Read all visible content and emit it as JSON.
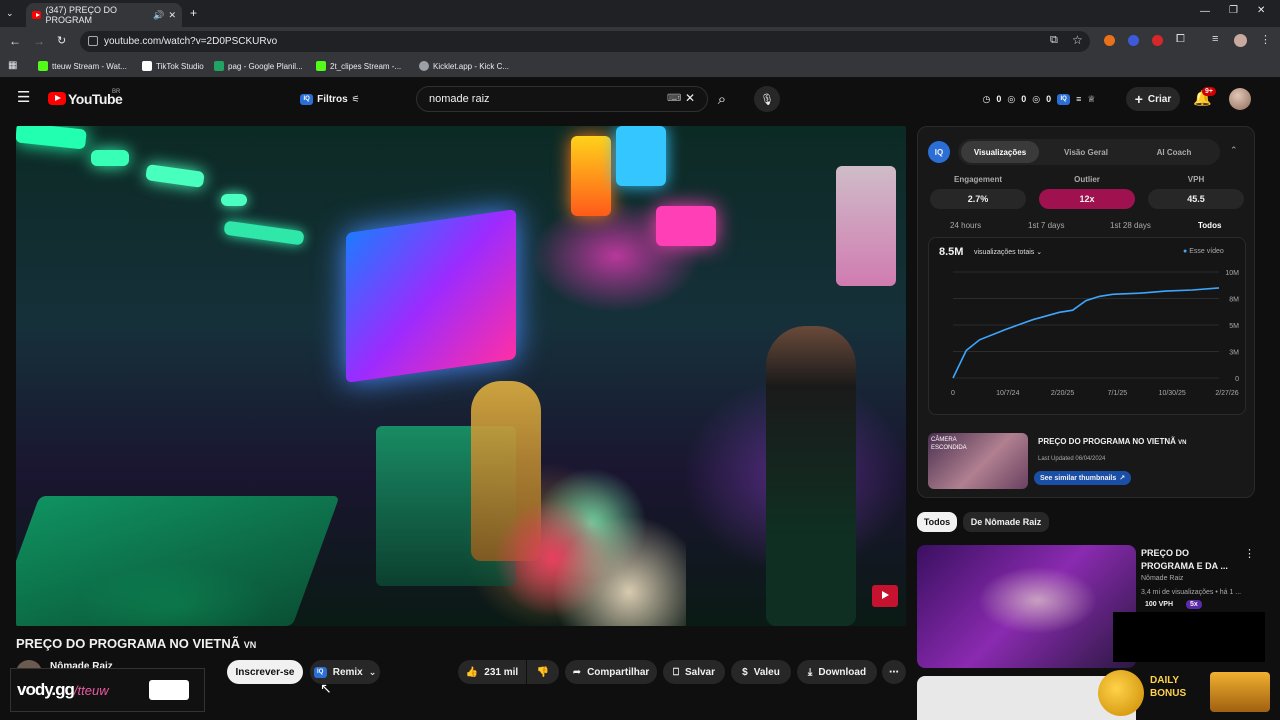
{
  "browser": {
    "tab_title": "(347) PREÇO DO PROGRAM",
    "url": "youtube.com/watch?v=2D0PSCKURvo",
    "bookmarks": [
      {
        "label": "tteuw Stream - Wat...",
        "color": "#53fc18"
      },
      {
        "label": "TikTok Studio",
        "color": "#ffffff"
      },
      {
        "label": "pag - Google Planil...",
        "color": "#1fa463"
      },
      {
        "label": "2t_clipes Stream -...",
        "color": "#53fc18"
      },
      {
        "label": "Kicklet.app - Kick C...",
        "color": "#9aa0a6"
      }
    ]
  },
  "header": {
    "logo_text": "YouTube",
    "region": "BR",
    "filters_label": "Filtros",
    "search_value": "nomade raiz",
    "stats": [
      "0",
      "0",
      "0"
    ],
    "create_label": "Criar",
    "notifications_badge": "9+"
  },
  "video": {
    "title": "PREÇO DO PROGRAMA NO VIETNÃ",
    "title_flag": "VN",
    "channel": "Nômade Raiz",
    "subscribe_label": "Inscrever-se",
    "remix_label": "Remix",
    "likes": "231 mil",
    "share_label": "Compartilhar",
    "save_label": "Salvar",
    "thanks_label": "Valeu",
    "download_label": "Download"
  },
  "panel": {
    "tabs": [
      "Visualizações",
      "Visão Geral",
      "AI Coach"
    ],
    "metrics": [
      {
        "label": "Engagement",
        "value": "2.7%"
      },
      {
        "label": "Outlier",
        "value": "12x"
      },
      {
        "label": "VPH",
        "value": "45.5"
      }
    ],
    "ranges": [
      "24 hours",
      "1st 7 days",
      "1st 28 days",
      "Todos"
    ],
    "total_views": "8.5M",
    "views_select": "visualizações totais",
    "legend": "Esse vídeo",
    "thumb_overlay": "CÂMERA ESCONDIDA",
    "video_title": "PREÇO DO PROGRAMA NO VIETNÃ",
    "video_flag": "VN",
    "last_updated": "Last Updated 06/04/2024",
    "similar_label": "See similar thumbnails"
  },
  "chart_data": {
    "type": "line",
    "x_ticks": [
      "0",
      "10/7/24",
      "2/20/25",
      "7/1/25",
      "10/30/25",
      "2/27/26"
    ],
    "y_ticks": [
      "10M",
      "8M",
      "5M",
      "3M",
      "0"
    ],
    "ylim": [
      0,
      10
    ],
    "x": [
      0,
      0.05,
      0.1,
      0.2,
      0.3,
      0.4,
      0.45,
      0.5,
      0.55,
      0.6,
      0.7,
      0.8,
      0.9,
      1.0
    ],
    "series": [
      {
        "name": "Esse vídeo",
        "values": [
          0,
          2.6,
          3.6,
          4.6,
          5.5,
          6.2,
          6.4,
          7.3,
          7.7,
          7.9,
          8.0,
          8.2,
          8.3,
          8.5
        ]
      }
    ]
  },
  "recommendations": {
    "chips": [
      "Todos",
      "De Nômade Raiz"
    ],
    "items": [
      {
        "title": "PREÇO DO PROGRAMA E DA ...",
        "channel": "Nômade Raiz",
        "meta": "3,4 mi de visualizações • há 1 ...",
        "vph": "100 VPH",
        "outlier": "5x"
      }
    ]
  },
  "overlay": {
    "brand": "vody.gg",
    "streamer": "/tteuw",
    "bonus": "DAILY BONUS"
  },
  "colors": {
    "accent": "#3ea6ff",
    "outlier": "#a0124f",
    "youtube_red": "#ff0000"
  }
}
